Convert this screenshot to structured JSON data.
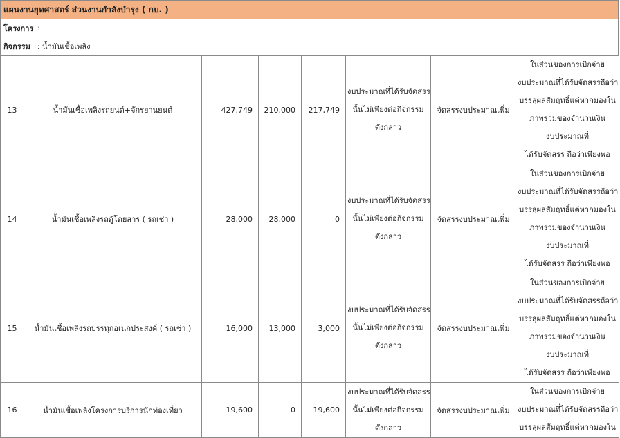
{
  "header": {
    "title": "แผนงานยุทศาสตร์ ส่วนงานกำลังบำรุง ( กบ. )",
    "project_label": "โครงการ",
    "project_value": ":",
    "activity_label": "กิจกรรม",
    "activity_value": ": น้ำมันเชื้อเพลิง"
  },
  "rows": [
    {
      "no": "13",
      "item": "น้ำมันเชื้อเพลิงรถยนต์+จักรยานยนต์",
      "amount_a": "427,749",
      "amount_b": "210,000",
      "amount_c": "217,749",
      "reason": [
        "งบประมาณที่ได้รับจัดสรร",
        "นั้นไม่เพียงต่อกิจกรรม",
        "ดังกล่าว"
      ],
      "action": "จัดสรรงบประมาณเพิ่ม",
      "note": [
        "ในส่วนของการเบิกจ่าย",
        "งบประมาณที่ได้รับจัดสรรถือว่า",
        "บรรลุผลสัมฤทธิ์แต่หากมองใน",
        "ภาพรวมของจำนวนเงิน",
        "งบประมาณที่",
        "ได้รับจัดสรร ถือว่าเพียงพอ"
      ]
    },
    {
      "no": "14",
      "item": "น้ำมันเชื้อเพลิงรถตู้โดยสาร ( รถเช่า )",
      "amount_a": "28,000",
      "amount_b": "28,000",
      "amount_c": "0",
      "reason": [
        "งบประมาณที่ได้รับจัดสรร",
        "นั้นไม่เพียงต่อกิจกรรม",
        "ดังกล่าว"
      ],
      "action": "จัดสรรงบประมาณเพิ่ม",
      "note": [
        "ในส่วนของการเบิกจ่าย",
        "งบประมาณที่ได้รับจัดสรรถือว่า",
        "บรรลุผลสัมฤทธิ์แต่หากมองใน",
        "ภาพรวมของจำนวนเงิน",
        "งบประมาณที่",
        "ได้รับจัดสรร ถือว่าเพียงพอ"
      ]
    },
    {
      "no": "15",
      "item": "น้ำมันเชื้อเพลิงรถบรรทุกอเนกประสงค์ ( รถเช่า )",
      "amount_a": "16,000",
      "amount_b": "13,000",
      "amount_c": "3,000",
      "reason": [
        "งบประมาณที่ได้รับจัดสรร",
        "นั้นไม่เพียงต่อกิจกรรม",
        "ดังกล่าว"
      ],
      "action": "จัดสรรงบประมาณเพิ่ม",
      "note": [
        "ในส่วนของการเบิกจ่าย",
        "งบประมาณที่ได้รับจัดสรรถือว่า",
        "บรรลุผลสัมฤทธิ์แต่หากมองใน",
        "ภาพรวมของจำนวนเงิน",
        "งบประมาณที่",
        "ได้รับจัดสรร ถือว่าเพียงพอ"
      ]
    },
    {
      "no": "16",
      "item": "น้ำมันเชื้อเพลิงโครงการบริการนักท่องเที่ยว",
      "amount_a": "19,600",
      "amount_b": "0",
      "amount_c": "19,600",
      "reason": [
        "งบประมาณที่ได้รับจัดสรร",
        "นั้นไม่เพียงต่อกิจกรรม",
        "ดังกล่าว"
      ],
      "action": "จัดสรรงบประมาณเพิ่ม",
      "note": [
        "ในส่วนของการเบิกจ่าย",
        "งบประมาณที่ได้รับจัดสรรถือว่า",
        "บรรลุผลสัมฤทธิ์แต่หากมองใน"
      ]
    }
  ]
}
